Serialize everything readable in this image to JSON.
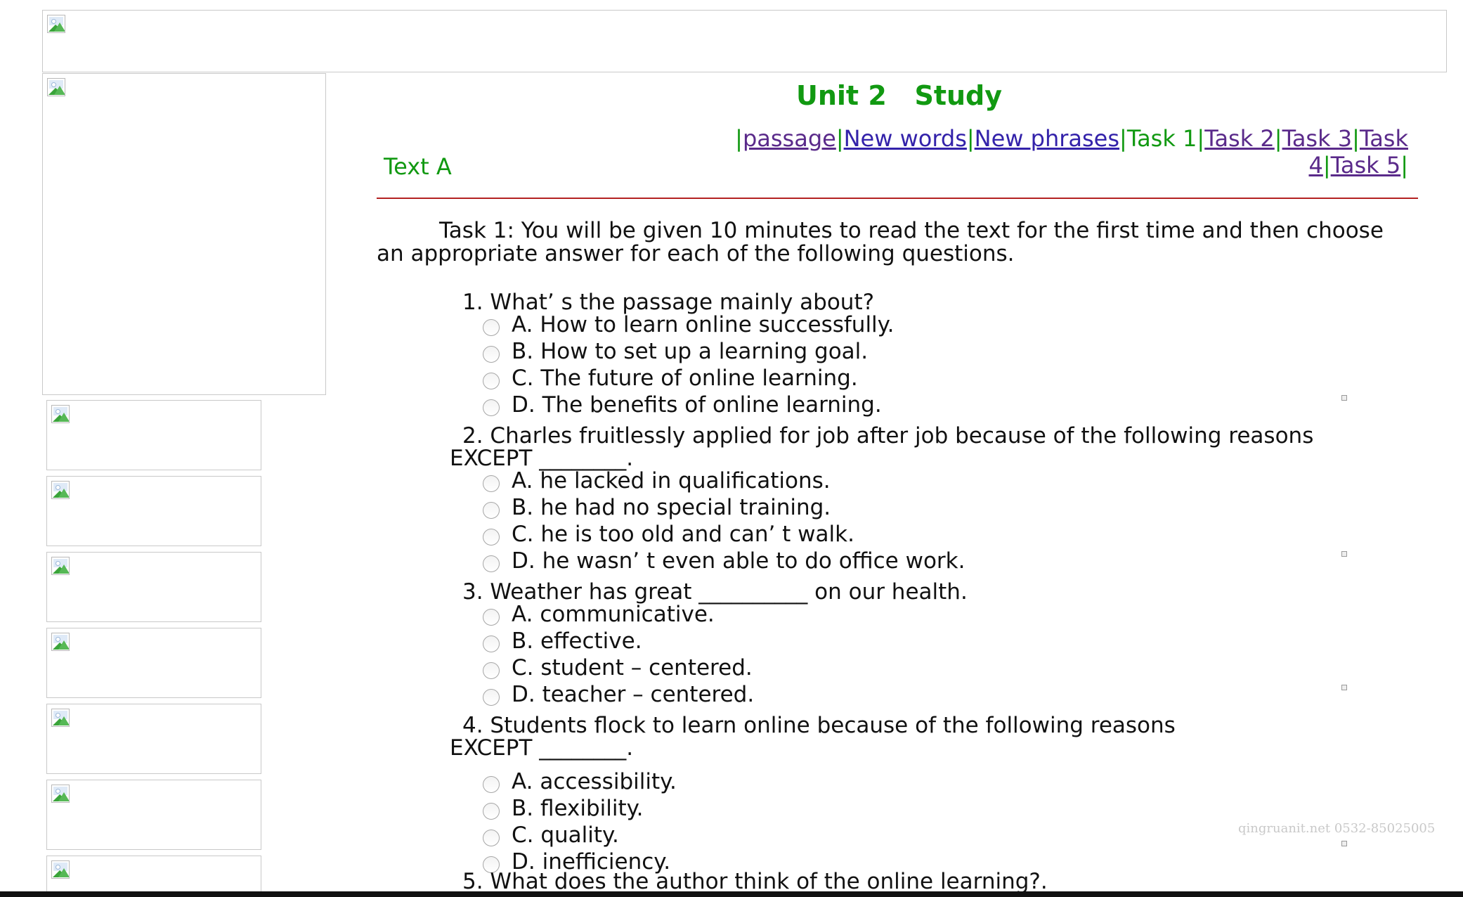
{
  "header": {
    "unit_title": "Unit 2   Study",
    "section_label": "Text A"
  },
  "nav": {
    "prefix": "|",
    "items": [
      {
        "label": "passage",
        "link": true,
        "visited": true
      },
      {
        "label": "New words",
        "link": true,
        "visited": false
      },
      {
        "label": "New phrases",
        "link": true,
        "visited": false
      },
      {
        "label": "Task 1",
        "link": false,
        "visited": false
      },
      {
        "label": "Task 2",
        "link": true,
        "visited": true
      },
      {
        "label": "Task 3",
        "link": true,
        "visited": true
      },
      {
        "label": "Task 4",
        "link": true,
        "visited": true
      },
      {
        "label": "Task 5",
        "link": true,
        "visited": true
      }
    ]
  },
  "task": {
    "intro": "Task 1: You will be given 10 minutes to read the text for the first time and then choose an appropriate answer for each of the following questions."
  },
  "questions": [
    {
      "text": "1. What’ s the passage mainly about?",
      "options": [
        "A. How to learn online successfully.",
        "B. How to set up a learning goal.",
        "C. The future of online learning.",
        "D. The benefits of online learning."
      ]
    },
    {
      "text": "2. Charles fruitlessly applied for job after job because of the following reasons EXCEPT ________.",
      "options": [
        "A. he lacked in qualifications.",
        "B. he had no special training.",
        "C. he is too old and can’ t walk.",
        "D. he wasn’ t even able to do office work."
      ]
    },
    {
      "text": "3. Weather has great __________ on our health.",
      "options": [
        "A. communicative.",
        "B. effective.",
        "C. student – centered.",
        "D. teacher – centered."
      ]
    },
    {
      "text": "4. Students flock to learn online because of the following reasons EXCEPT ________.",
      "options": [
        "A. accessibility.",
        "B. flexibility.",
        "C. quality.",
        "D. inefficiency."
      ]
    },
    {
      "text": "5. What does the author think of the online learning?.",
      "options": []
    }
  ],
  "watermark": "qingruanit.net 0532-85025005",
  "colors": {
    "heading_green": "#119911",
    "link_blue": "#3322aa",
    "link_visited": "#5a2a8a",
    "divider_red": "#b42222"
  }
}
